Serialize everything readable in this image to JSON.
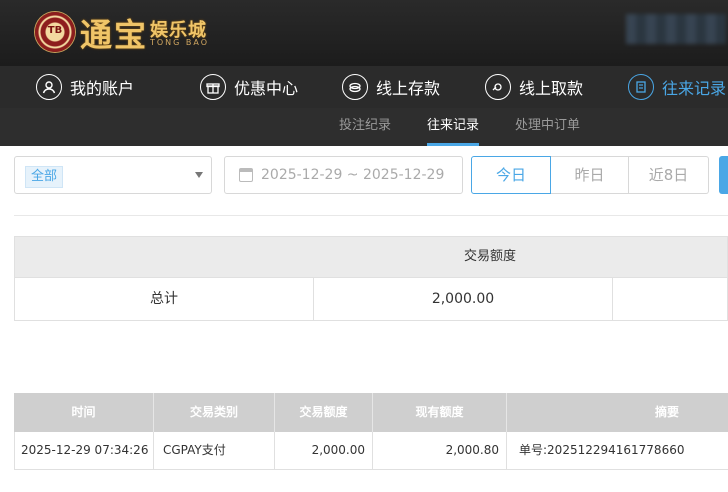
{
  "header": {
    "logo_chip": "TB",
    "logo_main": "通宝",
    "logo_sub": "娱乐城",
    "logo_en": "TONG BAO"
  },
  "nav": [
    {
      "label": "我的账户",
      "icon": "user-icon"
    },
    {
      "label": "优惠中心",
      "icon": "gift-icon"
    },
    {
      "label": "线上存款",
      "icon": "deposit-icon"
    },
    {
      "label": "线上取款",
      "icon": "withdraw-icon"
    },
    {
      "label": "往来记录",
      "icon": "records-icon",
      "active": true
    }
  ],
  "subnav": [
    {
      "label": "投注纪录"
    },
    {
      "label": "往来记录",
      "active": true
    },
    {
      "label": "处理中订单"
    }
  ],
  "filter": {
    "type_value": "全部",
    "date_range": "2025-12-29 ~ 2025-12-29",
    "quick": [
      "今日",
      "昨日",
      "近8日"
    ],
    "quick_active": "今日"
  },
  "summary": {
    "header": "交易额度",
    "total_label": "总计",
    "total_value": "2,000.00"
  },
  "table": {
    "columns": [
      "时间",
      "交易类别",
      "交易额度",
      "现有额度",
      "摘要"
    ],
    "rows": [
      [
        "2025-12-29 07:34:26",
        "CGPAY支付",
        "2,000.00",
        "2,000.80",
        "单号:202512294161778660"
      ]
    ]
  },
  "colors": {
    "accent": "#4aa7e6",
    "header_bg": "#2b2b2b",
    "table_head_bg": "#cfcfcf"
  }
}
